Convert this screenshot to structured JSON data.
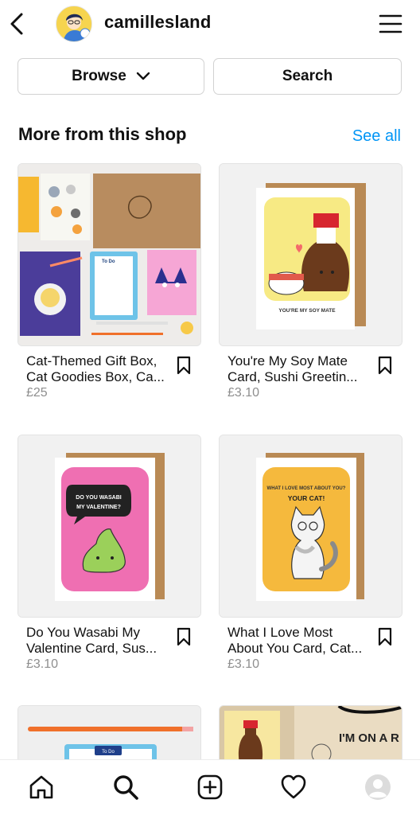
{
  "header": {
    "shop_name": "camillesland",
    "icons": {
      "back": "back-arrow-icon",
      "menu": "hamburger-menu-icon"
    }
  },
  "actions": {
    "browse_label": "Browse",
    "search_label": "Search"
  },
  "section": {
    "title": "More from this shop",
    "see_all": "See all",
    "accent_color": "#0095f6"
  },
  "products": [
    {
      "name": "Cat-Themed Gift Box, Cat Goodies Box, Ca...",
      "price": "£25"
    },
    {
      "name": "You're My Soy Mate Card, Sushi Greetin...",
      "price": "£3.10"
    },
    {
      "name": "Do You Wasabi My Valentine Card, Sus...",
      "price": "£3.10"
    },
    {
      "name": "What I Love Most About You Card, Cat...",
      "price": "£3.10"
    }
  ],
  "image_text": {
    "soy": "YOU'RE MY SOY MATE",
    "wasabi_l1": "DO YOU WASABI",
    "wasabi_l2": "MY VALENTINE?",
    "cat_l1": "WHAT I LOVE MOST ABOUT YOU?",
    "cat_l2": "YOUR CAT!",
    "todo": "To Do",
    "bag": "I'M ON A R"
  },
  "tabbar": {
    "icons": [
      "home-icon",
      "search-icon",
      "create-post-icon",
      "activity-heart-icon",
      "profile-avatar-icon"
    ]
  }
}
